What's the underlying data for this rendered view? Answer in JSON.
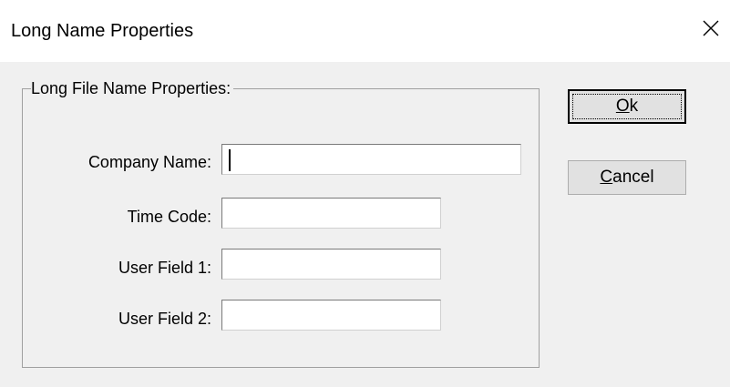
{
  "window": {
    "title": "Long Name Properties",
    "close_symbol": "✕"
  },
  "group": {
    "label": "Long File Name Properties:"
  },
  "fields": {
    "company_name": {
      "label": "Company Name:",
      "value": ""
    },
    "time_code": {
      "label": "Time Code:",
      "value": ""
    },
    "user_field_1": {
      "label": "User Field 1:",
      "value": ""
    },
    "user_field_2": {
      "label": "User Field 2:",
      "value": ""
    }
  },
  "buttons": {
    "ok": {
      "accel": "O",
      "rest": "k"
    },
    "cancel": {
      "accel": "C",
      "rest": "ancel"
    }
  }
}
